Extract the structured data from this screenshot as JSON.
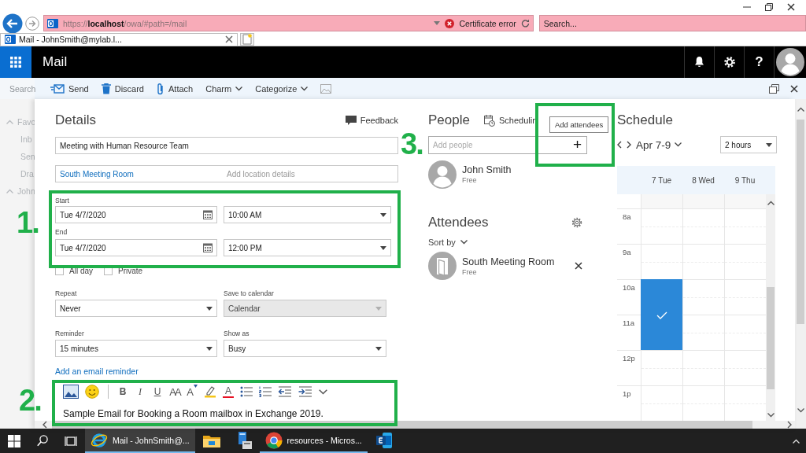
{
  "browser": {
    "address": {
      "url": "https://**localhost**/owa/#path=/mail",
      "status": "Certificate error"
    },
    "search": {
      "placeholder": "Search..."
    },
    "tabs": [
      {
        "title": "Mail - JohnSmith@mylab.l...",
        "selected": true
      }
    ]
  },
  "app_bar": {
    "title": "Mail",
    "help": "?"
  },
  "sidebar": {
    "search_placeholder": "Search",
    "items": [
      {
        "label": "Favo",
        "kind": "group",
        "expanded": true
      },
      {
        "label": "Inb",
        "kind": "folder"
      },
      {
        "label": "Sen",
        "kind": "folder"
      },
      {
        "label": "Dra",
        "kind": "folder"
      },
      {
        "label": "John",
        "kind": "group",
        "expanded": true
      }
    ]
  },
  "toolbar": {
    "actions": [
      {
        "label": "Send",
        "kind": "send"
      },
      {
        "label": "Discard",
        "kind": "discard"
      },
      {
        "label": "Attach",
        "kind": "attach"
      },
      {
        "label": "Charm",
        "kind": "menu"
      },
      {
        "label": "Categorize",
        "kind": "menu"
      },
      {
        "kind": "image"
      }
    ]
  },
  "details": {
    "title": "Details",
    "feedback": "Feedback",
    "subject": "Meeting with Human Resource Team",
    "location": {
      "value": "South Meeting Room",
      "placeholder": "Add location details"
    },
    "start": {
      "label": "Start",
      "date": "Tue 4/7/2020",
      "time": "10:00 AM"
    },
    "end": {
      "label": "End",
      "date": "Tue 4/7/2020",
      "time": "12:00 PM"
    },
    "checkboxes": [
      {
        "label": "All day",
        "checked": false
      },
      {
        "label": "Private",
        "checked": false
      }
    ],
    "selects": [
      {
        "label": "Repeat",
        "value": "Never",
        "disabled": false
      },
      {
        "label": "Save to calendar",
        "value": "Calendar",
        "disabled": true
      },
      {
        "label": "Reminder",
        "value": "15 minutes",
        "disabled": false
      },
      {
        "label": "Show as",
        "value": "Busy",
        "disabled": false
      }
    ],
    "email_reminder_link": "Add an email reminder",
    "editor": {
      "tools": [
        {
          "kind": "picture"
        },
        {
          "kind": "emoji"
        },
        {
          "kind": "separator"
        },
        {
          "kind": "bold",
          "label": "B"
        },
        {
          "kind": "italic",
          "label": "I"
        },
        {
          "kind": "underline",
          "label": "U"
        },
        {
          "kind": "size",
          "label": "AA"
        },
        {
          "kind": "grow",
          "label": "A"
        },
        {
          "kind": "highlight"
        },
        {
          "kind": "fontcolor",
          "label": "A"
        },
        {
          "kind": "bullets"
        },
        {
          "kind": "numbering"
        },
        {
          "kind": "outdent"
        },
        {
          "kind": "indent"
        },
        {
          "kind": "more"
        }
      ],
      "body": "Sample Email for Booking a Room mailbox in Exchange 2019."
    }
  },
  "people": {
    "title": "People",
    "scheduling": "Schedulin",
    "tooltip": "Add attendees",
    "add_people": {
      "placeholder": "Add people"
    },
    "add_button": "+",
    "organizer": {
      "name": "John Smith",
      "status": "Free"
    },
    "attendees": {
      "title": "Attendees",
      "sort_label": "Sort by",
      "items": [
        {
          "name": "South Meeting Room",
          "status": "Free",
          "kind": "room"
        }
      ]
    }
  },
  "schedule": {
    "title": "Schedule",
    "range": "Apr 7-9",
    "duration": "2 hours",
    "days": [
      "7 Tue",
      "8 Wed",
      "9 Thu"
    ],
    "hours": [
      {
        "label": "8a",
        "slots": [
          false,
          false,
          false
        ]
      },
      {
        "label": "9a",
        "slots": [
          false,
          false,
          false
        ]
      },
      {
        "label": "10a",
        "slots": [
          true,
          false,
          false
        ]
      },
      {
        "label": "11a",
        "slots": [
          true,
          false,
          false
        ]
      },
      {
        "label": "12p",
        "slots": [
          false,
          false,
          false
        ]
      },
      {
        "label": "1p",
        "slots": [
          false,
          false,
          false
        ]
      }
    ]
  },
  "taskbar": {
    "apps": [
      {
        "kind": "ie",
        "label": "Mail - JohnSmith@...",
        "selected": true
      },
      {
        "kind": "explorer",
        "selected": false
      },
      {
        "kind": "server",
        "selected": false
      },
      {
        "kind": "chrome",
        "label": "resources - Micros...",
        "selected": false
      },
      {
        "kind": "exchange",
        "selected": false
      }
    ]
  },
  "annotations": [
    {
      "label": "1."
    },
    {
      "label": "2."
    },
    {
      "label": "3."
    }
  ]
}
